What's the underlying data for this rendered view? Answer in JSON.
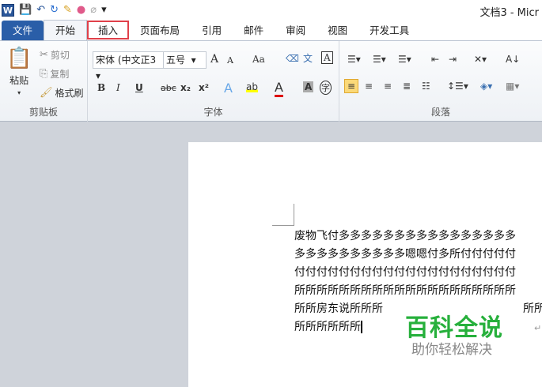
{
  "title": "文档3 - Micr",
  "quick_access": {
    "word": "W",
    "save": "💾",
    "undo": "↶",
    "redo": "↻",
    "customize": "▾"
  },
  "tabs": [
    "文件",
    "开始",
    "插入",
    "页面布局",
    "引用",
    "邮件",
    "审阅",
    "视图",
    "开发工具"
  ],
  "clipboard": {
    "paste": "粘贴",
    "cut": "剪切",
    "copy": "复制",
    "format_painter": "格式刷",
    "label": "剪贴板"
  },
  "font": {
    "name": "宋体 (中文正3",
    "size": "五号",
    "grow": "A",
    "shrink": "A",
    "case": "Aa",
    "bold": "B",
    "italic": "I",
    "underline": "U",
    "strike": "abc",
    "sub": "x₂",
    "sup": "x²",
    "color": "A",
    "shade": "A",
    "circle": "字",
    "label": "字体"
  },
  "paragraph": {
    "label": "段落"
  },
  "document": {
    "lines": [
      "废物飞付多多多多多多多多多多多多多多多多",
      "多多多多多多多多多多嗯嗯付多所付付付付付",
      "付付付付付付付付付付付付付付付付付付付付",
      "所所所所所所所所所所所所所所所所所所所所",
      "所所房东说所所所",
      "所所所所所所"
    ],
    "line5_right": "所所",
    "para_mark": "↵"
  },
  "watermark": {
    "title": "百科全说",
    "subtitle": "助你轻松解决"
  }
}
